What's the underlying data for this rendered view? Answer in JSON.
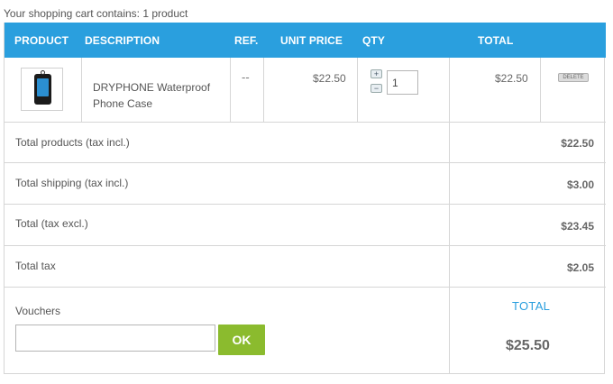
{
  "summary": "Your shopping cart contains: 1 product",
  "columns": {
    "product": "PRODUCT",
    "description": "DESCRIPTION",
    "ref": "REF.",
    "unit_price": "UNIT PRICE",
    "qty": "QTY",
    "total": "TOTAL"
  },
  "item": {
    "name": "DRYPHONE Waterproof Phone Case",
    "ref": "--",
    "unit_price": "$22.50",
    "qty": "1",
    "total": "$22.50",
    "image_icon": "phone-case-thumbnail",
    "plus_label": "+",
    "minus_label": "−",
    "delete_label": "DELETE"
  },
  "totals": [
    {
      "label": "Total products (tax incl.)",
      "value": "$22.50"
    },
    {
      "label": "Total shipping (tax incl.)",
      "value": "$3.00"
    },
    {
      "label": "Total (tax excl.)",
      "value": "$23.45"
    },
    {
      "label": "Total tax",
      "value": "$2.05"
    }
  ],
  "vouchers": {
    "label": "Vouchers",
    "placeholder": "",
    "button": "OK"
  },
  "grand_total": {
    "label": "TOTAL",
    "value": "$25.50"
  },
  "colors": {
    "header": "#2a9fde",
    "ok_button": "#8bbb2e",
    "total_label": "#2a9fde"
  }
}
